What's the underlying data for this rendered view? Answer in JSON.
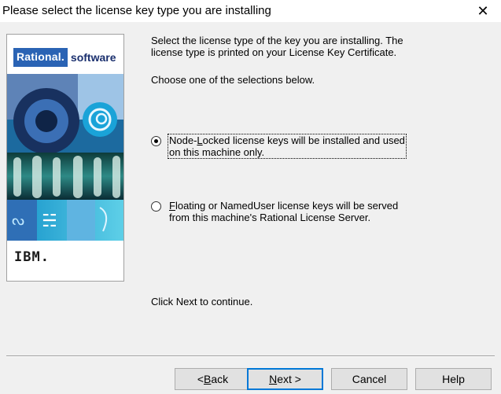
{
  "dialog": {
    "title": "Please select the license key type you are installing",
    "close_glyph": "✕"
  },
  "banner": {
    "brand_primary": "Rational.",
    "brand_secondary": "software",
    "vendor_logo": "IBM.",
    "brand_color": "#2a63b4"
  },
  "content": {
    "intro_line1": "Select the license type of the key you are installing.  The",
    "intro_line2": "license type is printed on your License Key Certificate.",
    "choose": "Choose one of the selections below.",
    "options": [
      {
        "line1_pre": "Node-",
        "line1_accel": "L",
        "line1_post": "ocked license keys will be installed and used",
        "line2": "on this machine only.",
        "selected": true
      },
      {
        "line1_pre": "",
        "line1_accel": "F",
        "line1_post": "loating or NamedUser license keys will be served",
        "line2": "from this machine's Rational License Server.",
        "selected": false
      }
    ],
    "footer_hint": "Click Next to continue."
  },
  "buttons": {
    "back_pre": "< ",
    "back_accel": "B",
    "back_post": "ack",
    "next_accel": "N",
    "next_post": "ext >",
    "cancel": "Cancel",
    "help": "Help"
  },
  "colors": {
    "focus_border": "#0078d7",
    "dialog_bg": "#f0f0f0"
  }
}
